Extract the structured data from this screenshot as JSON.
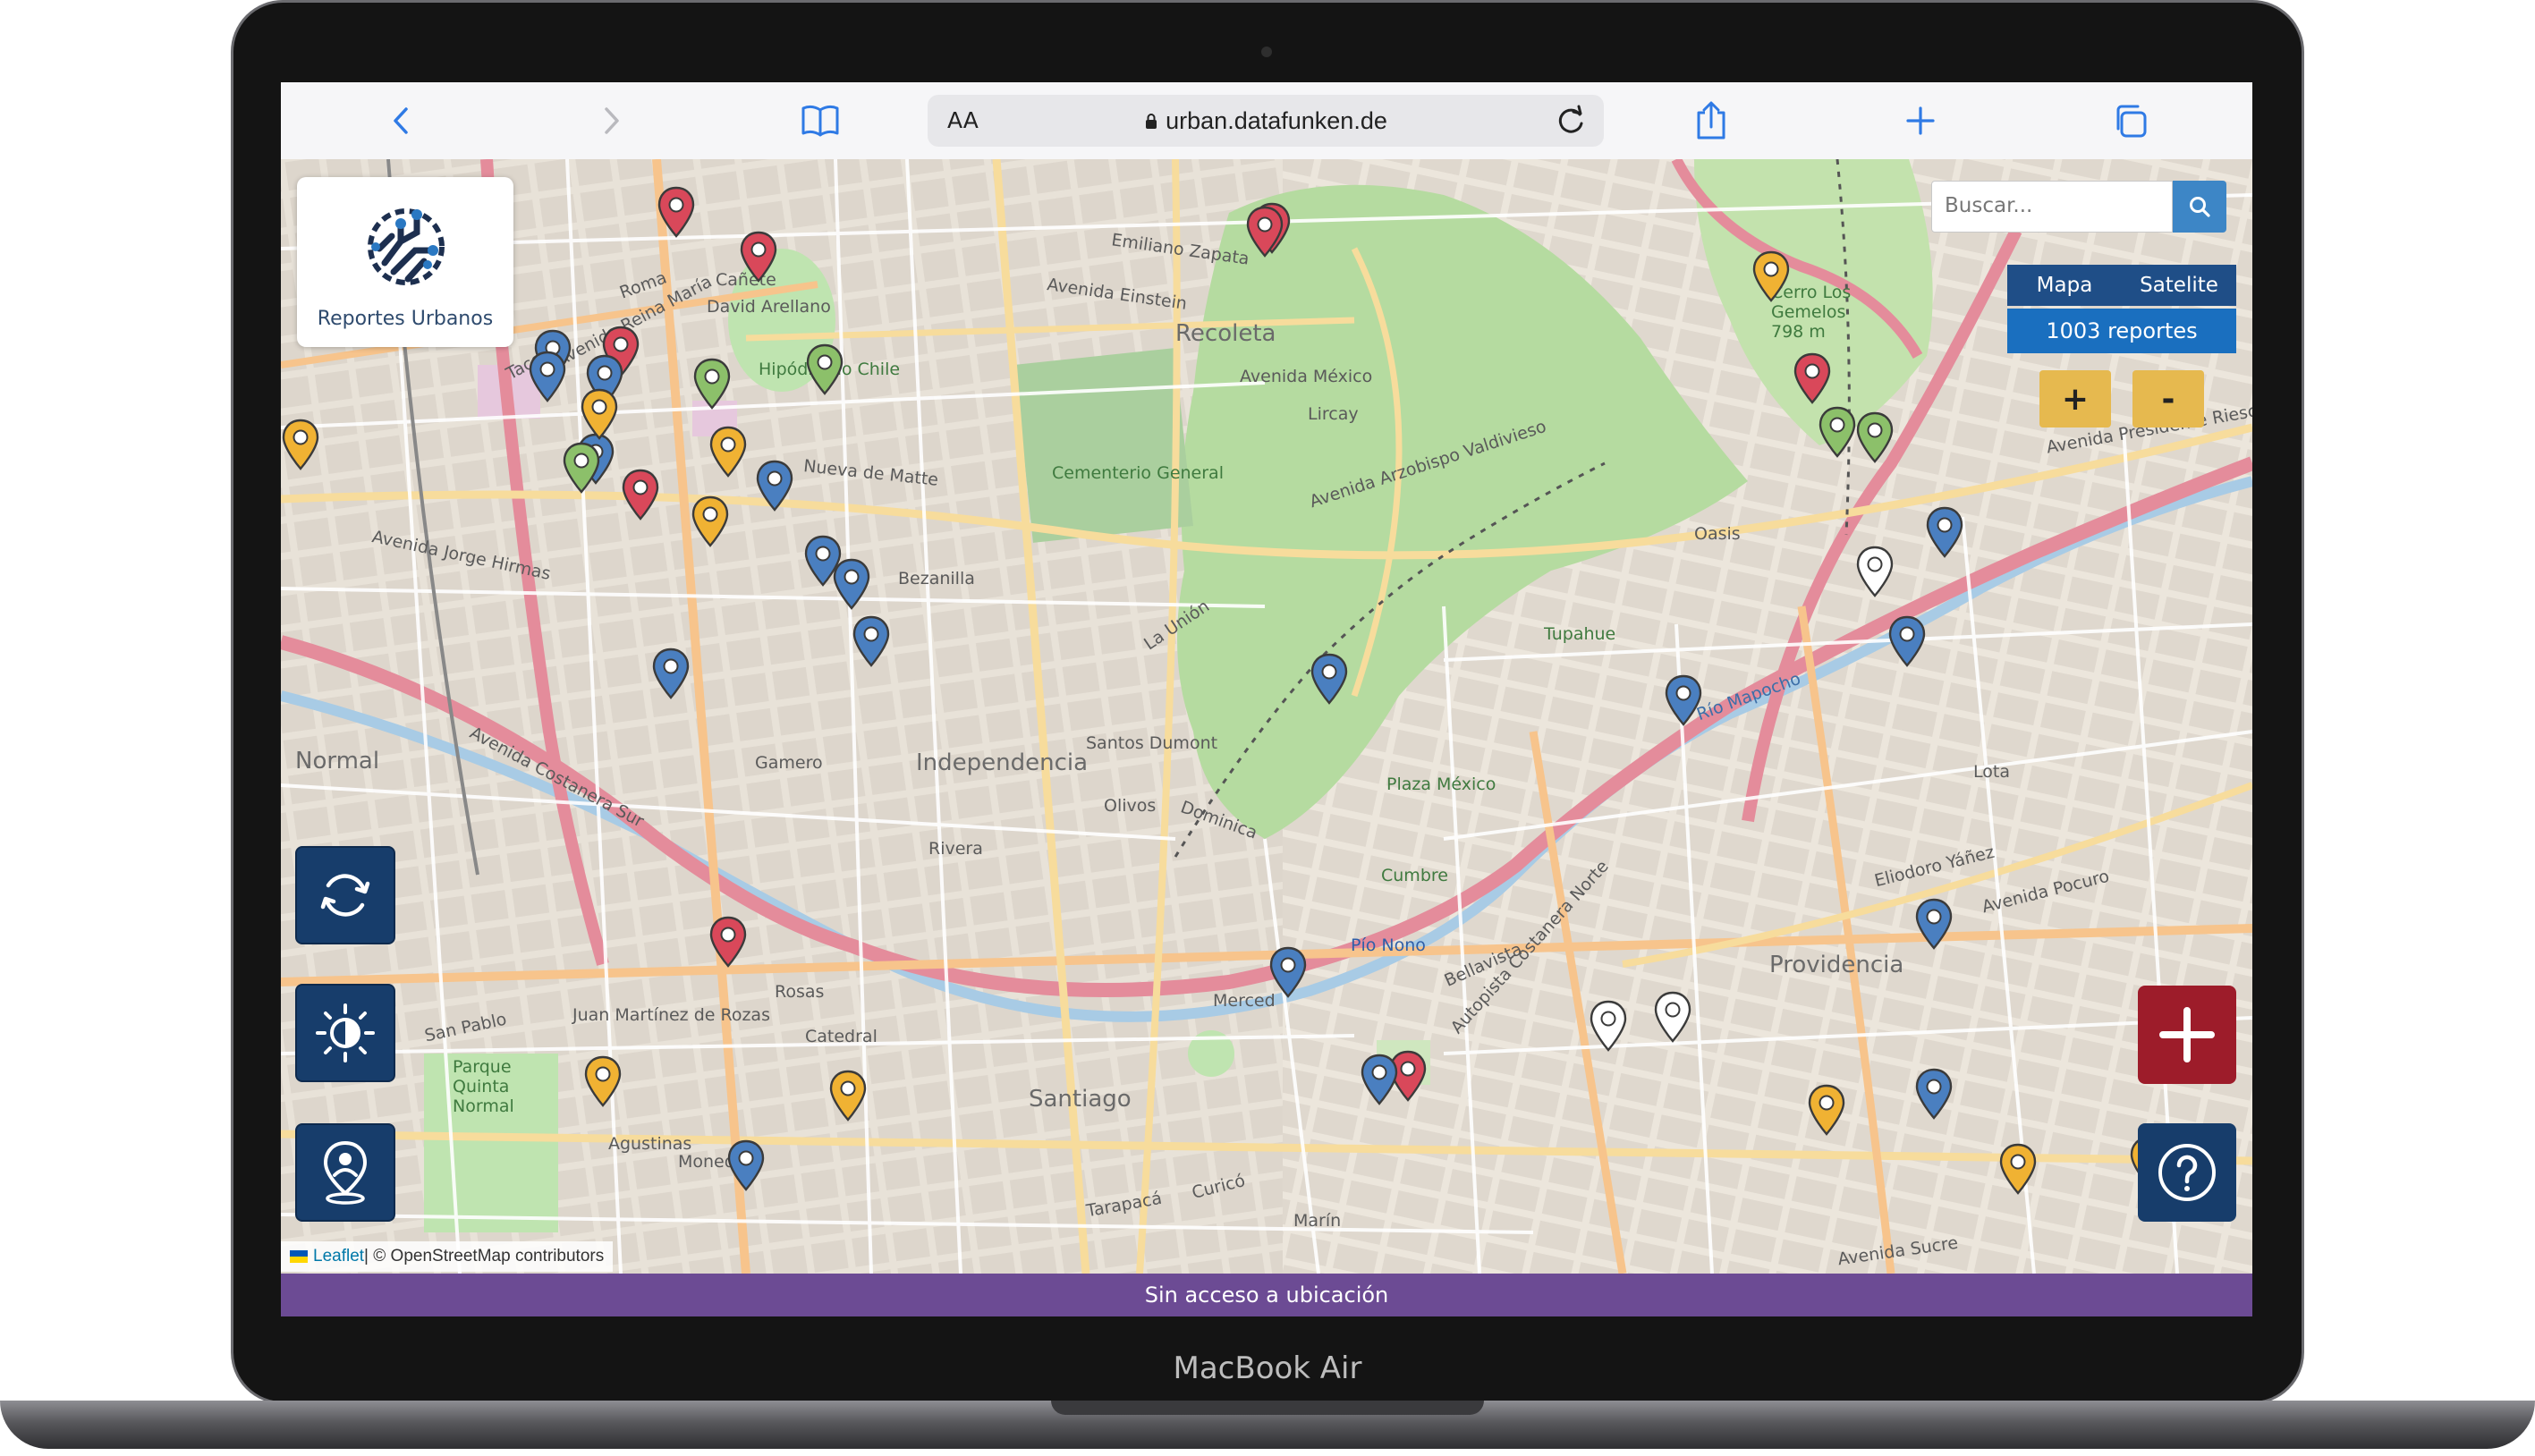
{
  "device": {
    "brand": "MacBook Air"
  },
  "browser": {
    "text_size_label": "AA",
    "url": "urban.datafunken.de"
  },
  "app": {
    "title": "Reportes Urbanos",
    "search": {
      "placeholder": "Buscar..."
    },
    "layers": {
      "map_label": "Mapa",
      "satellite_label": "Satelite"
    },
    "report_count": "1003 reportes",
    "zoom": {
      "in_label": "+",
      "out_label": "-"
    },
    "attribution": {
      "leaflet": "Leaflet",
      "rest": " | © OpenStreetMap contributors"
    },
    "status": "Sin acceso a ubicación",
    "colors": {
      "primary": "#173d6b",
      "accent": "#e6b94f",
      "add": "#9d1c2a",
      "status_bar": "#6c4b94",
      "count_bar": "#1a6fbf"
    }
  },
  "map_labels": [
    {
      "text": "Santiago"
    },
    {
      "text": "Independencia"
    },
    {
      "text": "Recoleta"
    },
    {
      "text": "Providencia"
    },
    {
      "text": "Cementerio General"
    },
    {
      "text": "Hipódromo Chile"
    },
    {
      "text": "Normal"
    },
    {
      "text": "Plaza México"
    },
    {
      "text": "Cumbre"
    },
    {
      "text": "Tupahue"
    },
    {
      "text": "Oasis"
    },
    {
      "text": "Pío Nono"
    },
    {
      "text": "Cerro Los Gemelos 798 m"
    },
    {
      "text": "Parque Quinta Normal"
    },
    {
      "text": "Avenida Einstein"
    },
    {
      "text": "Avenida México"
    },
    {
      "text": "Bellavista"
    },
    {
      "text": "Río Mapocho"
    },
    {
      "text": "Autopista Costanera Norte"
    },
    {
      "text": "Avenida Costanera Sur"
    },
    {
      "text": "Avenida Presidente Riesco"
    },
    {
      "text": "Eliodoro Yáñez"
    },
    {
      "text": "Avenida Pocuro"
    },
    {
      "text": "Tarapacá"
    },
    {
      "text": "Catedral"
    },
    {
      "text": "Merced"
    },
    {
      "text": "Agustinas"
    },
    {
      "text": "Moneda"
    },
    {
      "text": "Rosas"
    },
    {
      "text": "Bezanilla"
    },
    {
      "text": "Santos Dumont"
    },
    {
      "text": "Dominica"
    },
    {
      "text": "Olivos"
    },
    {
      "text": "Rivera"
    },
    {
      "text": "Gamero"
    },
    {
      "text": "Avenida Jorge Hirmas"
    },
    {
      "text": "Nueva de Matte"
    },
    {
      "text": "Emiliano Zapata"
    },
    {
      "text": "Lircay"
    },
    {
      "text": "Avenida Arzobispo Valdivieso"
    },
    {
      "text": "La Unión"
    },
    {
      "text": "Avenida Reina María"
    },
    {
      "text": "Tacora"
    },
    {
      "text": "Cañete"
    },
    {
      "text": "David Arellano"
    },
    {
      "text": "Roma"
    },
    {
      "text": "San Pablo"
    },
    {
      "text": "Juan Martínez de Rozas"
    },
    {
      "text": "Lota"
    },
    {
      "text": "Avenida Sucre"
    },
    {
      "text": "Curicó"
    },
    {
      "text": "Marín"
    }
  ],
  "markers": [
    {
      "category": "red"
    },
    {
      "category": "red"
    },
    {
      "category": "red"
    },
    {
      "category": "red"
    },
    {
      "category": "red"
    },
    {
      "category": "red"
    },
    {
      "category": "red"
    },
    {
      "category": "red"
    },
    {
      "category": "red"
    },
    {
      "category": "red"
    },
    {
      "category": "blue"
    },
    {
      "category": "blue"
    },
    {
      "category": "blue"
    },
    {
      "category": "blue"
    },
    {
      "category": "blue"
    },
    {
      "category": "blue"
    },
    {
      "category": "blue"
    },
    {
      "category": "blue"
    },
    {
      "category": "blue"
    },
    {
      "category": "blue"
    },
    {
      "category": "blue"
    },
    {
      "category": "blue"
    },
    {
      "category": "blue"
    },
    {
      "category": "blue"
    },
    {
      "category": "blue"
    },
    {
      "category": "blue"
    },
    {
      "category": "blue"
    },
    {
      "category": "blue"
    },
    {
      "category": "orange"
    },
    {
      "category": "orange"
    },
    {
      "category": "orange"
    },
    {
      "category": "orange"
    },
    {
      "category": "orange"
    },
    {
      "category": "orange"
    },
    {
      "category": "orange"
    },
    {
      "category": "orange"
    },
    {
      "category": "orange"
    },
    {
      "category": "orange"
    },
    {
      "category": "green"
    },
    {
      "category": "green"
    },
    {
      "category": "green"
    },
    {
      "category": "green"
    },
    {
      "category": "green"
    },
    {
      "category": "white"
    },
    {
      "category": "white"
    },
    {
      "category": "white"
    }
  ],
  "marker_colors": {
    "red": "#d9485a",
    "blue": "#4a7fc0",
    "orange": "#f0b233",
    "green": "#8cc06a",
    "white": "#ffffff"
  }
}
